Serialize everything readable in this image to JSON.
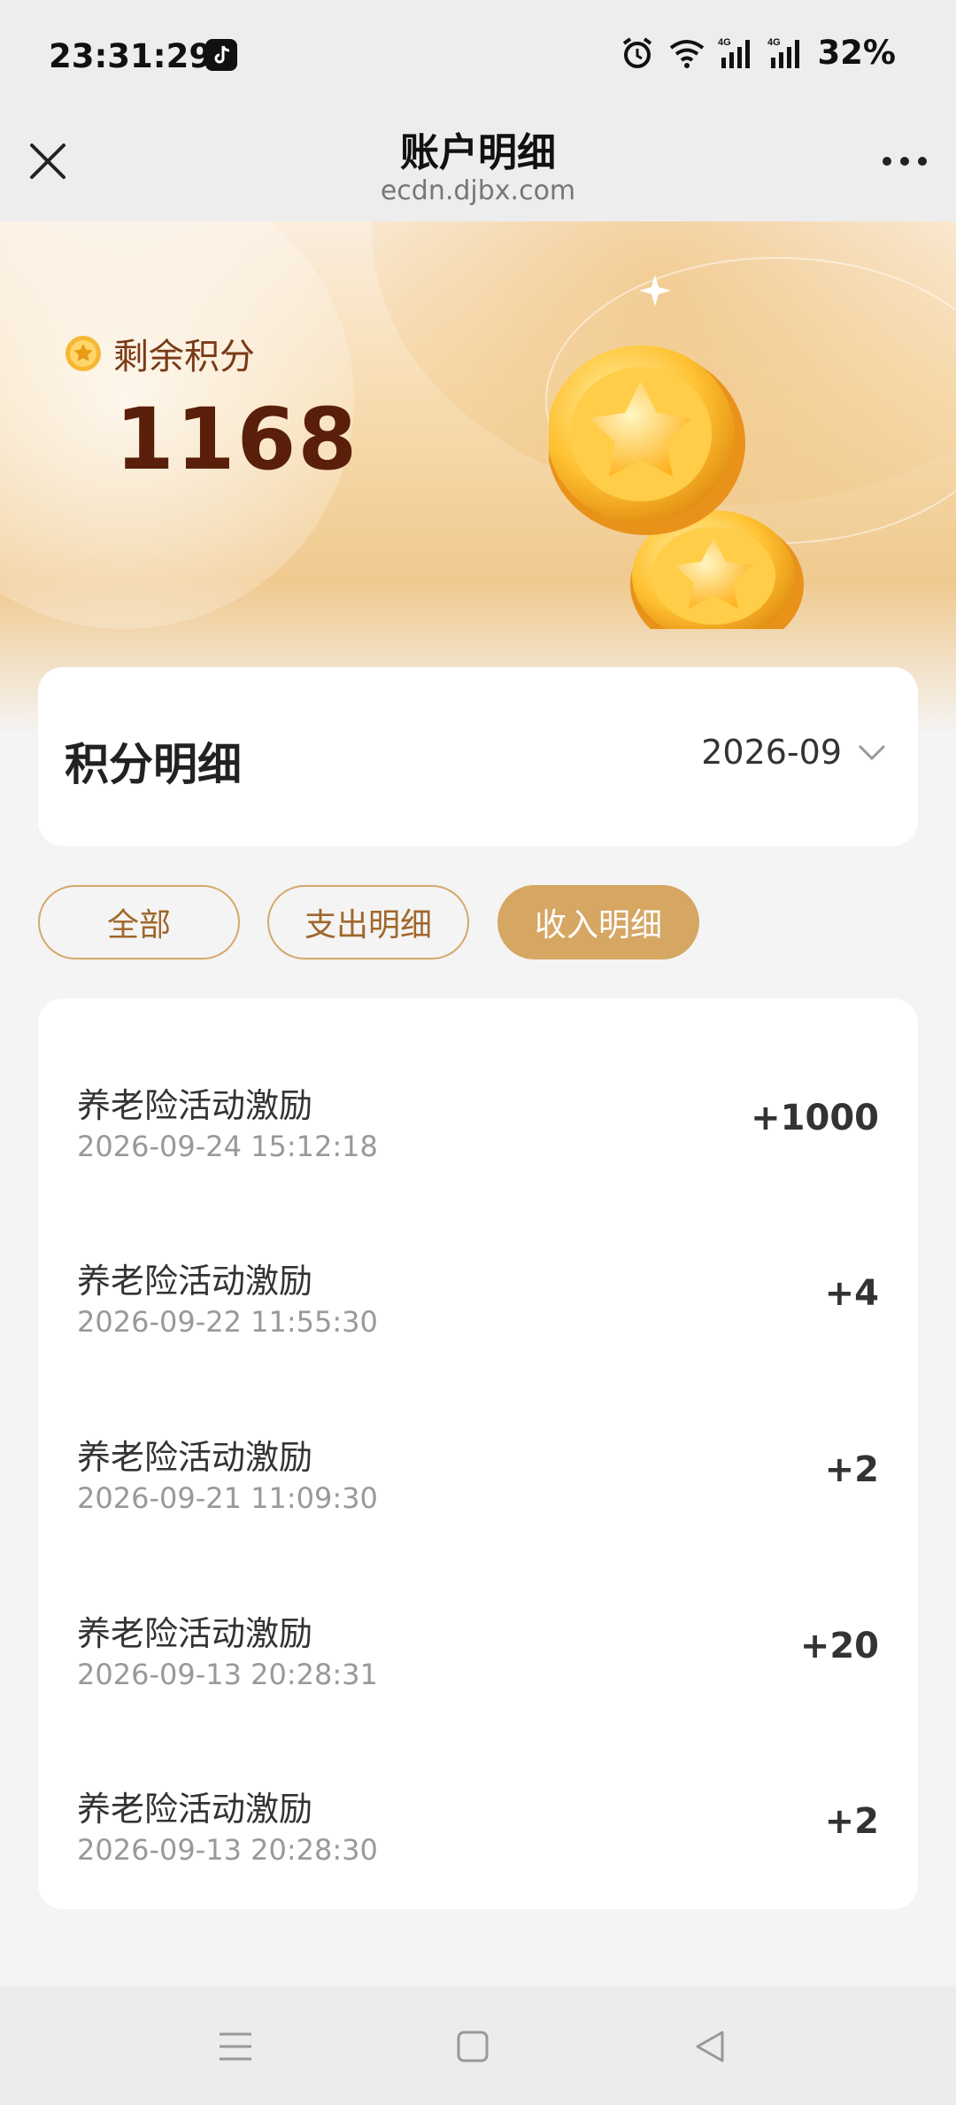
{
  "status_bar": {
    "time": "23:31:29",
    "battery": "32%"
  },
  "titlebar": {
    "title": "账户明细",
    "subtitle": "ecdn.djbx.com"
  },
  "hero": {
    "label": "剩余积分",
    "points": "1168"
  },
  "detail_header": {
    "title": "积分明细",
    "month": "2026-09"
  },
  "tabs": [
    {
      "label": "全部",
      "active": false
    },
    {
      "label": "支出明细",
      "active": false
    },
    {
      "label": "收入明细",
      "active": true
    }
  ],
  "records": [
    {
      "name": "养老险活动激励",
      "date": "2026-09-24 15:12:18",
      "amount": "+1000"
    },
    {
      "name": "养老险活动激励",
      "date": "2026-09-22 11:55:30",
      "amount": "+4"
    },
    {
      "name": "养老险活动激励",
      "date": "2026-09-21 11:09:30",
      "amount": "+2"
    },
    {
      "name": "养老险活动激励",
      "date": "2026-09-13 20:28:31",
      "amount": "+20"
    },
    {
      "name": "养老险活动激励",
      "date": "2026-09-13 20:28:30",
      "amount": "+2"
    }
  ],
  "colors": {
    "accent": "#d6a663",
    "accent_text": "#a0672a",
    "points": "#5a1f0a"
  }
}
